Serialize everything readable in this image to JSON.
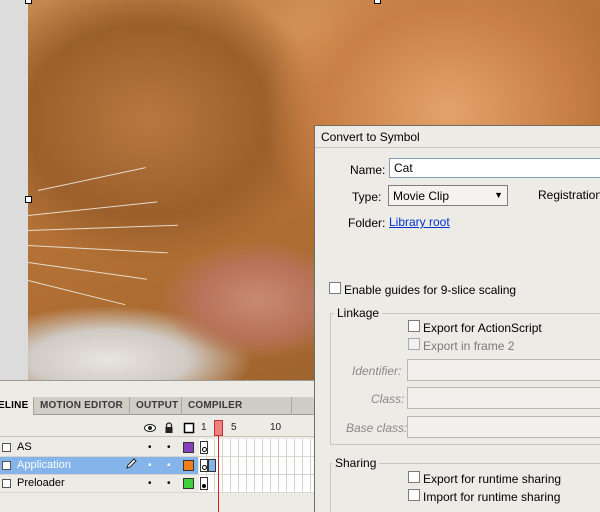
{
  "timeline": {
    "tabs": [
      "ELINE",
      "MOTION EDITOR",
      "OUTPUT",
      "COMPILER ERRORS"
    ],
    "frame_numbers": [
      "1",
      "5",
      "10"
    ],
    "header_icons": [
      "eye-icon",
      "lock-icon",
      "outline-icon"
    ],
    "layers": [
      {
        "name": "AS",
        "color": "#8a3fc0",
        "selected": false
      },
      {
        "name": "Application",
        "color": "#f07e1a",
        "selected": true
      },
      {
        "name": "Preloader",
        "color": "#3fcf3f",
        "selected": false
      }
    ]
  },
  "dialog": {
    "title": "Convert to Symbol",
    "name_label": "Name:",
    "name_value": "Cat",
    "type_label": "Type:",
    "type_value": "Movie Clip",
    "registration_label": "Registration:",
    "folder_label": "Folder:",
    "folder_value": "Library root",
    "nine_slice_label": "Enable guides for 9-slice scaling",
    "linkage": {
      "legend": "Linkage",
      "export_as": "Export for ActionScript",
      "export_frame2": "Export in frame 2",
      "identifier_label": "Identifier:",
      "class_label": "Class:",
      "base_class_label": "Base class:"
    },
    "sharing": {
      "legend": "Sharing",
      "export_runtime": "Export for runtime sharing",
      "import_runtime": "Import for runtime sharing"
    }
  }
}
